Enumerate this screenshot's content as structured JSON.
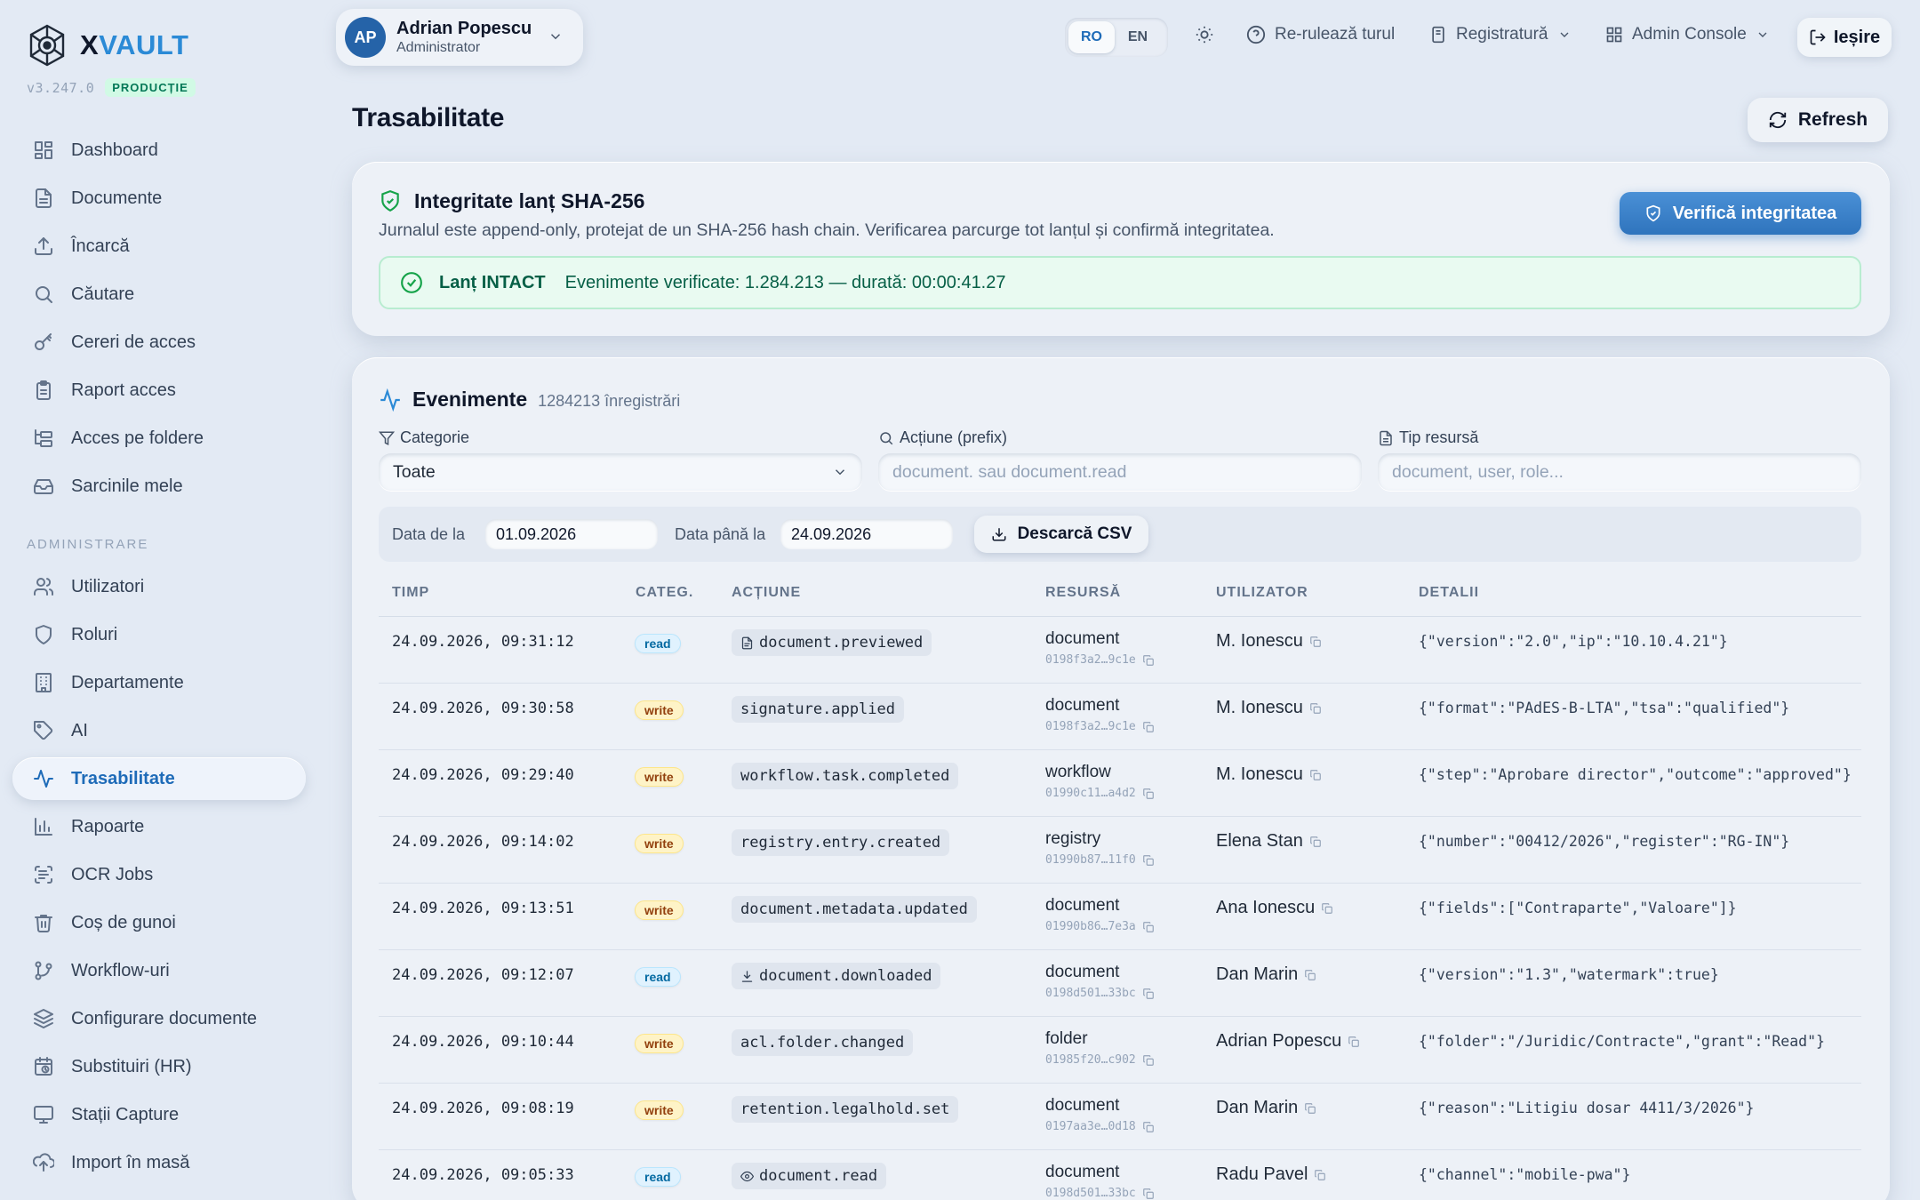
{
  "brand": {
    "prefix": "X",
    "accent": "VAULT",
    "version": "v3.247.0",
    "env": "PRODUCȚIE"
  },
  "nav": {
    "main": [
      {
        "label": "Dashboard",
        "icon": "dashboard-icon"
      },
      {
        "label": "Documente",
        "icon": "document-icon"
      },
      {
        "label": "Încarcă",
        "icon": "upload-icon"
      },
      {
        "label": "Căutare",
        "icon": "search-icon"
      },
      {
        "label": "Cereri de acces",
        "icon": "key-icon"
      },
      {
        "label": "Raport acces",
        "icon": "clipboard-icon"
      },
      {
        "label": "Acces pe foldere",
        "icon": "folder-tree-icon"
      },
      {
        "label": "Sarcinile mele",
        "icon": "inbox-icon"
      }
    ],
    "section_label": "ADMINISTRARE",
    "admin": [
      {
        "label": "Utilizatori",
        "icon": "users-icon"
      },
      {
        "label": "Roluri",
        "icon": "shield-icon"
      },
      {
        "label": "Departamente",
        "icon": "building-icon"
      },
      {
        "label": "AI",
        "icon": "tag-icon"
      },
      {
        "label": "Trasabilitate",
        "icon": "activity-icon",
        "active": true
      },
      {
        "label": "Rapoarte",
        "icon": "bar-chart-icon"
      },
      {
        "label": "OCR Jobs",
        "icon": "scan-text-icon"
      },
      {
        "label": "Coș de gunoi",
        "icon": "trash-icon"
      },
      {
        "label": "Workflow-uri",
        "icon": "git-branch-icon"
      },
      {
        "label": "Configurare documente",
        "icon": "layers-icon"
      },
      {
        "label": "Substituiri (HR)",
        "icon": "calendar-clock-icon"
      },
      {
        "label": "Stații Capture",
        "icon": "monitor-icon"
      },
      {
        "label": "Import în masă",
        "icon": "cloud-upload-icon"
      }
    ]
  },
  "user": {
    "initials": "AP",
    "name": "Adrian Popescu",
    "role": "Administrator"
  },
  "topbar": {
    "lang": [
      "RO",
      "EN"
    ],
    "active_lang": "RO",
    "rerun_tour": "Re-rulează turul",
    "registry": "Registratură",
    "admin_console": "Admin Console",
    "logout": "Ieșire"
  },
  "page": {
    "title": "Trasabilitate",
    "refresh": "Refresh"
  },
  "integrity": {
    "title": "Integritate lanț SHA-256",
    "description": "Jurnalul este append-only, protejat de un SHA-256 hash chain. Verificarea parcurge tot lanțul și confirmă integritatea.",
    "verify_button": "Verifică integritatea",
    "status_label": "Lanț INTACT",
    "status_detail": "Evenimente verificate: 1.284.213 — durată: 00:00:41.27"
  },
  "events": {
    "title": "Evenimente",
    "count": "1284213 înregistrări",
    "filters": {
      "category_label": "Categorie",
      "category_value": "Toate",
      "action_label": "Acțiune (prefix)",
      "action_placeholder": "document. sau document.read",
      "resource_label": "Tip resursă",
      "resource_placeholder": "document, user, role..."
    },
    "date_from_label": "Data de la",
    "date_from": "01.09.2026",
    "date_to_label": "Data până la",
    "date_to": "24.09.2026",
    "csv_button": "Descarcă CSV",
    "columns": [
      "TIMP",
      "CATEG.",
      "ACȚIUNE",
      "RESURSĂ",
      "UTILIZATOR",
      "DETALII"
    ],
    "rows": [
      {
        "time": "24.09.2026, 09:31:12",
        "cat": "read",
        "action": "document.previewed",
        "action_icon": "file-icon",
        "res_type": "document",
        "res_id": "0198f3a2…9c1e",
        "user": "M. Ionescu",
        "details": "{\"version\":\"2.0\",\"ip\":\"10.10.4.21\"}"
      },
      {
        "time": "24.09.2026, 09:30:58",
        "cat": "write",
        "action": "signature.applied",
        "action_icon": "",
        "res_type": "document",
        "res_id": "0198f3a2…9c1e",
        "user": "M. Ionescu",
        "details": "{\"format\":\"PAdES-B-LTA\",\"tsa\":\"qualified\"}"
      },
      {
        "time": "24.09.2026, 09:29:40",
        "cat": "write",
        "action": "workflow.task.completed",
        "action_icon": "",
        "res_type": "workflow",
        "res_id": "01990c11…a4d2",
        "user": "M. Ionescu",
        "details": "{\"step\":\"Aprobare director\",\"outcome\":\"approved\"}"
      },
      {
        "time": "24.09.2026, 09:14:02",
        "cat": "write",
        "action": "registry.entry.created",
        "action_icon": "",
        "res_type": "registry",
        "res_id": "01990b87…11f0",
        "user": "Elena Stan",
        "details": "{\"number\":\"00412/2026\",\"register\":\"RG-IN\"}"
      },
      {
        "time": "24.09.2026, 09:13:51",
        "cat": "write",
        "action": "document.metadata.updated",
        "action_icon": "",
        "res_type": "document",
        "res_id": "01990b86…7e3a",
        "user": "Ana Ionescu",
        "details": "{\"fields\":[\"Contraparte\",\"Valoare\"]}"
      },
      {
        "time": "24.09.2026, 09:12:07",
        "cat": "read",
        "action": "document.downloaded",
        "action_icon": "download-icon",
        "res_type": "document",
        "res_id": "0198d501…33bc",
        "user": "Dan Marin",
        "details": "{\"version\":\"1.3\",\"watermark\":true}"
      },
      {
        "time": "24.09.2026, 09:10:44",
        "cat": "write",
        "action": "acl.folder.changed",
        "action_icon": "",
        "res_type": "folder",
        "res_id": "01985f20…c902",
        "user": "Adrian Popescu",
        "details": "{\"folder\":\"/Juridic/Contracte\",\"grant\":\"Read\"}"
      },
      {
        "time": "24.09.2026, 09:08:19",
        "cat": "write",
        "action": "retention.legalhold.set",
        "action_icon": "",
        "res_type": "document",
        "res_id": "0197aa3e…0d18",
        "user": "Dan Marin",
        "details": "{\"reason\":\"Litigiu dosar 4411/3/2026\"}"
      },
      {
        "time": "24.09.2026, 09:05:33",
        "cat": "read",
        "action": "document.read",
        "action_icon": "eye-icon",
        "res_type": "document",
        "res_id": "0198d501…33bc",
        "user": "Radu Pavel",
        "details": "{\"channel\":\"mobile-pwa\"}"
      }
    ]
  },
  "colors": {
    "accent": "#2b8ad6",
    "success": "#16a34a",
    "background": "#e3eaf4"
  }
}
